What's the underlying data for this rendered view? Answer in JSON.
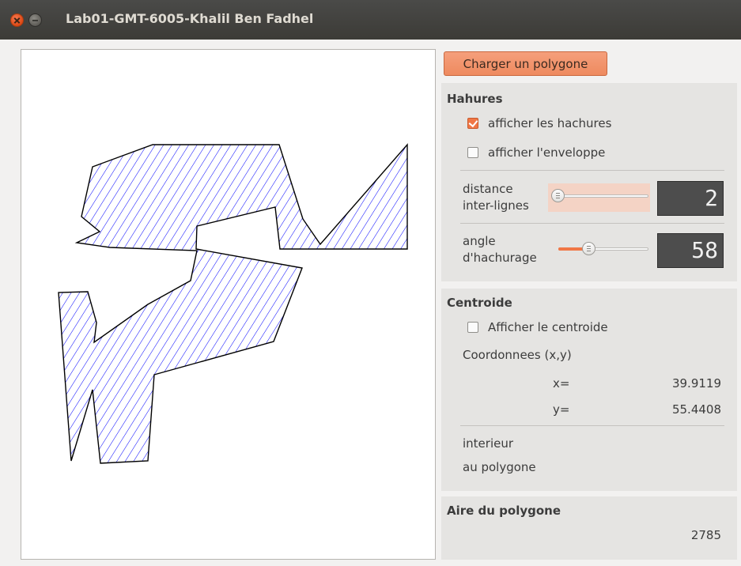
{
  "window": {
    "title": "Lab01-GMT-6005-Khalil Ben Fadhel"
  },
  "canvas": {
    "polygon_fill": "#ffffff",
    "hatch_color": "#0000ff",
    "outline_color": "#000000"
  },
  "controls": {
    "load_button": "Charger un polygone",
    "hatch_group": {
      "title": "Hahures",
      "show_hatch_label": "afficher les hachures",
      "show_hatch_checked": true,
      "show_envelope_label": "afficher l'enveloppe",
      "show_envelope_checked": false,
      "distance_label_1": "distance",
      "distance_label_2": "inter-lignes",
      "distance_value": "2",
      "distance_slider_fraction": 0.0,
      "angle_label_1": "angle",
      "angle_label_2": "d'hachurage",
      "angle_value": "58",
      "angle_slider_fraction": 0.32
    },
    "centroid_group": {
      "title": "Centroide",
      "show_centroid_label": "Afficher le centroide",
      "show_centroid_checked": false,
      "coords_label": "Coordonnees (x,y)",
      "x_label": "x=",
      "x_value": "39.9119",
      "y_label": "y=",
      "y_value": "55.4408",
      "interior_line1": "interieur",
      "interior_line2": "au polygone"
    },
    "area_group": {
      "title": "Aire du polygone",
      "value": "2785"
    }
  },
  "colors": {
    "accent": "#f07746",
    "titlebar": "#3c3b37",
    "lcd_background": "#4d4d4d"
  }
}
